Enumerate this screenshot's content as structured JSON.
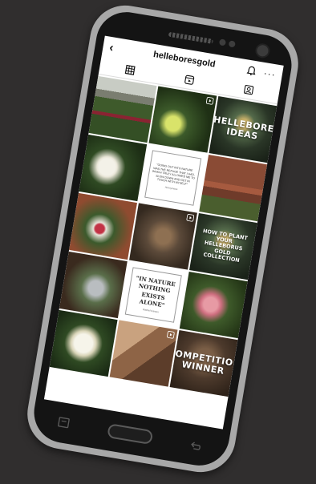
{
  "header": {
    "username": "helleboresgold",
    "back_icon": "back-arrow-icon",
    "bell_icon": "bell-icon",
    "more_label": "···"
  },
  "tabs": [
    {
      "icon": "grid-icon"
    },
    {
      "icon": "reels-icon"
    },
    {
      "icon": "tagged-icon"
    }
  ],
  "posts": {
    "hellebore_ideas": "HELLEBORE IDEAS",
    "quote1_text": "\"Going out into nature was the refuge that I had, which truly allowed me to slow down and get in touch with myself\"",
    "quote1_author": "Anonymous",
    "how_to_plant": "HOW TO PLANT YOUR HELLEBORUS GOLD COLLECTION",
    "quote2_text": "\"IN NATURE NOTHING EXISTS ALONE\"",
    "quote2_author": "Rachel Carson",
    "competition": "COMPETITION WINNER"
  },
  "colors": {
    "background": "#302e2e",
    "phone_body": "#a8a8a8",
    "bezel": "#141414"
  }
}
